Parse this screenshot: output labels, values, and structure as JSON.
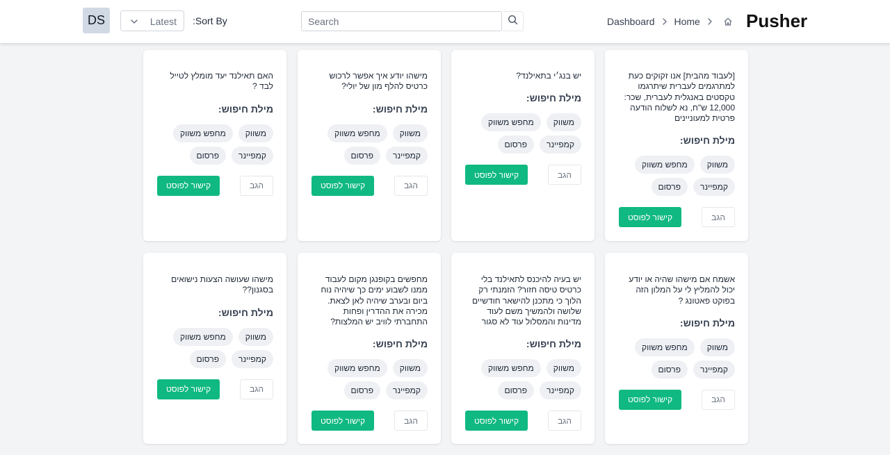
{
  "header": {
    "avatar_initials": "DS",
    "sort_value": "Latest",
    "sort_label": ":Sort By",
    "search_placeholder": "Search",
    "breadcrumbs": [
      "Dashboard",
      "Home"
    ],
    "brand": "Pusher"
  },
  "common": {
    "keywords_title": "מילת חיפוש:",
    "chips": [
      "משווק",
      "מחפש משווק",
      "קמפיינר",
      "פרסום"
    ],
    "link_label": "קישור לפוסט",
    "report_label": "הגב"
  },
  "cards": [
    {
      "text": "[לעבוד מהבית] אנו זקוקים כעת למתרגמים לעברית שיתרגמו טקסטים באנגלית לעברית, שכר: 12,000 ש\"ח, נא לשלוח הודעה פרטית למעוניינים"
    },
    {
      "text": "יש בנג׳י בתאילנד?"
    },
    {
      "text": "מישהו יודע איך אפשר לרכוש כרטיס להלף מון של יולי?"
    },
    {
      "text": "האם תאילנד יעד מומלץ לטייל לבד ?"
    },
    {
      "text": "אשמח אם מישהו שהיה או יודע יכול להמליץ לי על המלון הזה בפוקט פאטונג ?"
    },
    {
      "text": "יש בעיה להיכנס לתאילנד בלי כרטיס טיסה חזור? הזמנתי רק הלוך כי מתכנן להישאר חודשיים שלושה ולהמשיך משם לעוד מדינות והמסלול עוד לא סגור"
    },
    {
      "text": "מחפשים בקופנגן מקום לעבוד ממנו לשבוע ימים כך שיהיה נוח ביום ובערב שיהיה לאן לצאת. מכירה את ההדרין ופחות התחברתי לוויב יש המלצות?"
    },
    {
      "text": "מישהו שעושה הצעות נישואים בסגנון??"
    }
  ]
}
